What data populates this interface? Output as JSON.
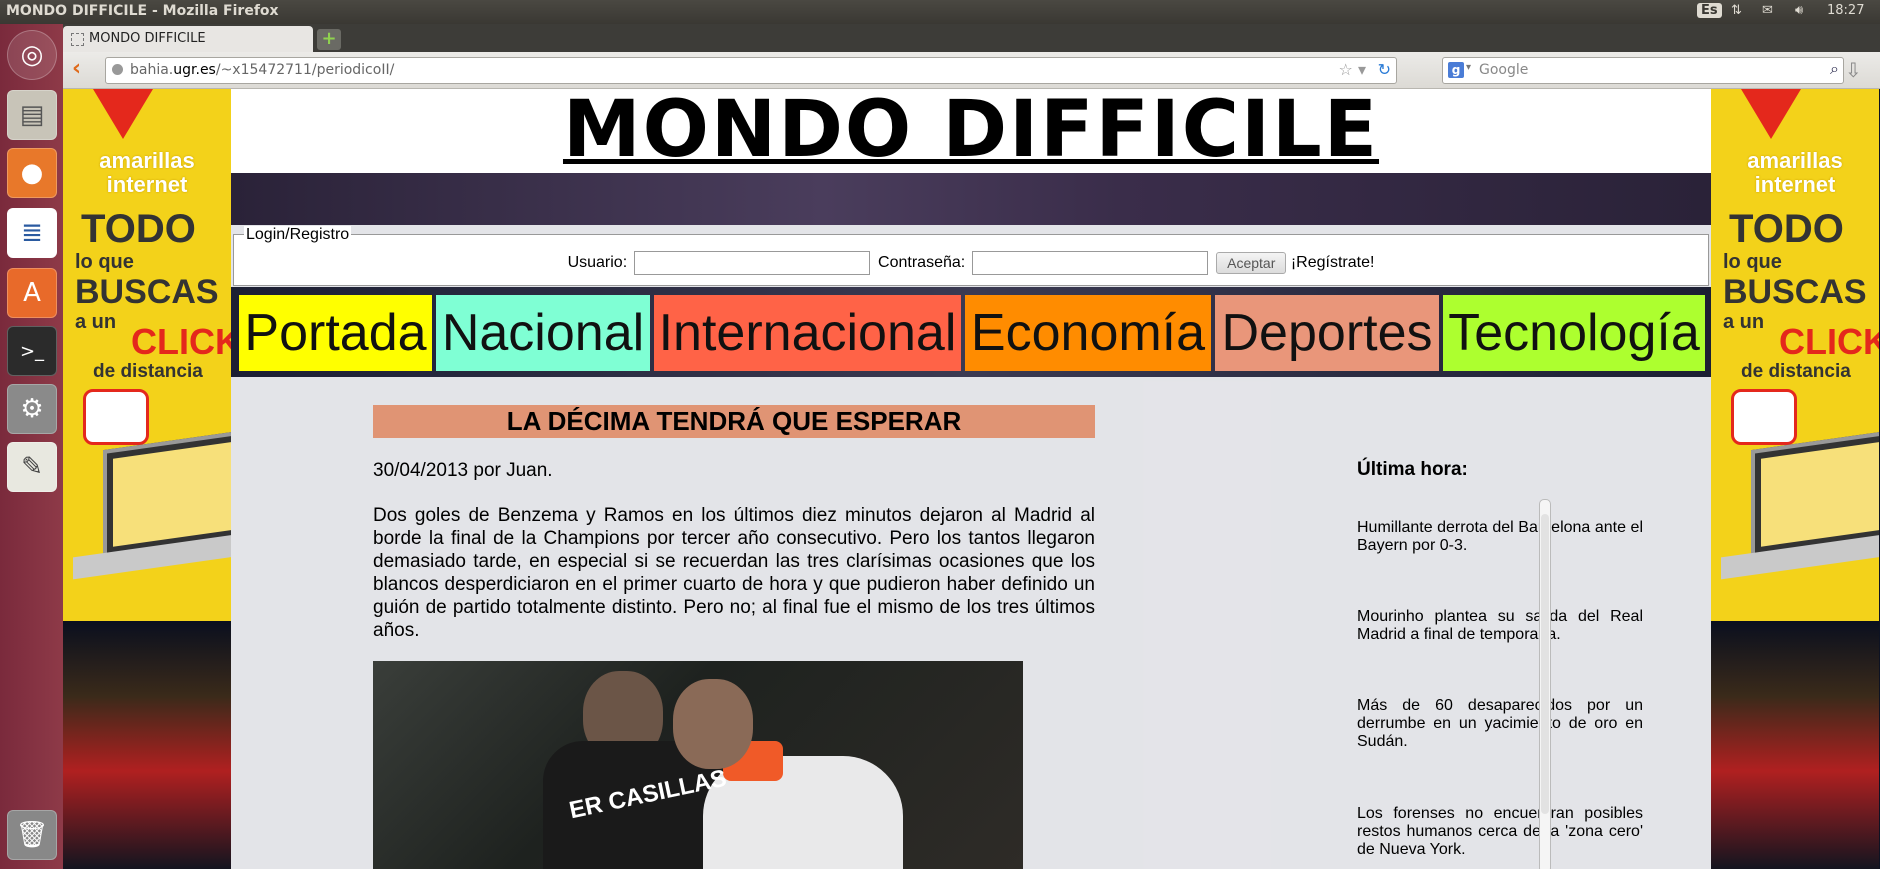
{
  "topbar": {
    "window_title": "MONDO DIFFICILE - Mozilla Firefox",
    "keyboard_layout": "Es",
    "clock": "18:27"
  },
  "launcher": {
    "items": [
      "ubuntu-dash",
      "file-cabinet",
      "firefox",
      "libreoffice-writer",
      "ubuntu-software-center",
      "terminal",
      "system-settings",
      "text-editor",
      "trash"
    ]
  },
  "browser": {
    "tab_title": "MONDO DIFFICILE",
    "new_tab_symbol": "+",
    "url_host": "bahia.",
    "url_domain": "ugr.es",
    "url_path": "/~x15472711/periodicoII/",
    "search_placeholder": "Google"
  },
  "ads": {
    "brand_line1": "amarillas",
    "brand_line2": "internet",
    "todo": "TODO",
    "lo_que": "lo que",
    "buscas": "BUSCAS",
    "a_un": "a un",
    "click": "CLICK",
    "de_distancia": "de distancia"
  },
  "site": {
    "title": "MONDO DIFFICILE"
  },
  "login": {
    "legend": "Login/Registro",
    "user_label": "Usuario:",
    "user_value": "",
    "password_label": "Contraseña:",
    "password_value": "",
    "submit_label": "Aceptar",
    "register_link": "¡Regístrate!"
  },
  "nav": [
    {
      "label": "Portada",
      "color": "#ffff00"
    },
    {
      "label": "Nacional",
      "color": "#7fffd4"
    },
    {
      "label": "Internacional",
      "color": "#ff6347"
    },
    {
      "label": "Economía",
      "color": "#ff8c00"
    },
    {
      "label": "Deportes",
      "color": "#e9967a"
    },
    {
      "label": "Tecnología",
      "color": "#adff2f"
    }
  ],
  "article": {
    "headline": "LA DÉCIMA TENDRÁ QUE ESPERAR",
    "byline": "30/04/2013 por Juan.",
    "body": "Dos goles de Benzema y Ramos en los últimos diez minutos dejaron al Madrid al borde la final de la Champions por tercer año consecutivo. Pero los tantos llegaron demasiado tarde, en especial si se recuerdan las tres clarísimas ocasiones que los blancos desperdiciaron en el primer cuarto de hora y que pudieron haber definido un guión de partido totalmente distinto. Pero no; al final fue el mismo de los tres últimos años.",
    "photo_jersey_text": "ER CASILLAS"
  },
  "sidebar": {
    "title": "Última hora:",
    "news": [
      "Humillante derrota del Barcelona ante el Bayern por 0-3.",
      "Mourinho plantea su salida del Real Madrid a final de temporada.",
      "Más de 60 desaparecidos por un derrumbe en un yacimiento de oro en Sudán.",
      "Los forenses no encuentran posibles restos humanos cerca de la 'zona cero' de Nueva York."
    ]
  }
}
